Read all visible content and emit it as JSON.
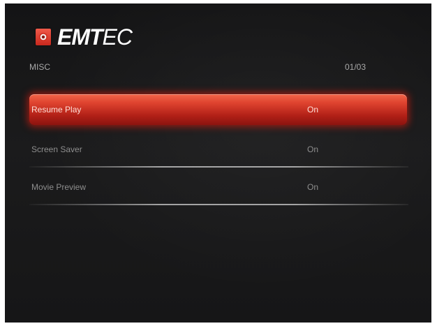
{
  "brand": {
    "name_bold": "EMT",
    "name_light": "EC",
    "icon": "emtec-disc-logo-icon"
  },
  "header": {
    "section_title": "MISC",
    "page_indicator": "01/03"
  },
  "menu": {
    "items": [
      {
        "label": "Resume Play",
        "value": "On",
        "selected": true
      },
      {
        "label": "Screen Saver",
        "value": "On",
        "selected": false
      },
      {
        "label": "Movie Preview",
        "value": "On",
        "selected": false
      }
    ]
  },
  "colors": {
    "highlight": "#d23a28",
    "background": "#18181a",
    "text": "#8e8e8e"
  }
}
